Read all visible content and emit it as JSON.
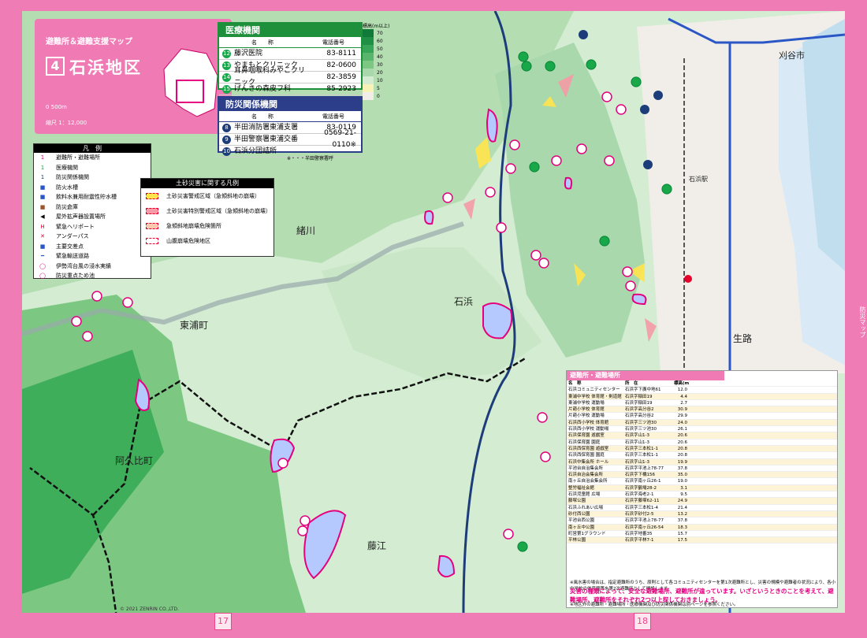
{
  "meta": {
    "sidetab": "防災マップ",
    "page_left": "17",
    "page_right": "18",
    "copyright": "© 2021 ZENRIN CO.,LTD."
  },
  "title": {
    "subtitle": "避難所＆避難支援マップ",
    "number": "4",
    "area": "石浜地区",
    "scale_bar": "0 500m",
    "scale": "縮尺 1：12,000"
  },
  "legend": {
    "title": "凡　例",
    "items": [
      {
        "symbol": "1",
        "color": "#e4007f",
        "label": "避難所・避難場所"
      },
      {
        "symbol": "1",
        "color": "#18a84a",
        "label": "医療機関"
      },
      {
        "symbol": "1",
        "color": "#1d3d7a",
        "label": "防災関係機関"
      },
      {
        "symbol": "■",
        "color": "#2a56c6",
        "label": "防火水槽"
      },
      {
        "symbol": "■",
        "color": "#2a56c6",
        "label": "飲料水兼用耐震性貯水槽"
      },
      {
        "symbol": "■",
        "color": "#a0522d",
        "label": "防災倉庫"
      },
      {
        "symbol": "◀",
        "color": "#000000",
        "label": "屋外拡声器設置場所"
      },
      {
        "symbol": "H",
        "color": "#e4002b",
        "label": "緊急ヘリポート"
      },
      {
        "symbol": "✕",
        "color": "#e4002b",
        "label": "アンダーパス"
      },
      {
        "symbol": "■",
        "color": "#2a56c6",
        "label": "主要交差点"
      },
      {
        "symbol": "━",
        "color": "#2a56c6",
        "label": "緊急輸送道路"
      },
      {
        "symbol": "◯",
        "color": "#e4007f",
        "label": "伊勢湾台風の浸水実績"
      },
      {
        "symbol": "◯",
        "color": "#e4007f",
        "label": "防災重点ため池"
      }
    ]
  },
  "disaster_legend": {
    "title": "土砂災害に関する凡例",
    "items": [
      {
        "color": "#ffe44a",
        "label": "土砂災害警戒区域（急傾斜地の崩壊）"
      },
      {
        "color": "#f59aa6",
        "label": "土砂災害特別警戒区域（急傾斜地の崩壊）"
      },
      {
        "color": "#f8c8b0",
        "label": "急傾斜地崩壊危険箇所"
      },
      {
        "color": "#ffffff",
        "label": "山腹崩壊危険地区"
      }
    ]
  },
  "elevation": {
    "title": "標高(m以上)",
    "levels": [
      {
        "value": "70",
        "color": "#0f7a3a"
      },
      {
        "value": "60",
        "color": "#1f8f45"
      },
      {
        "value": "50",
        "color": "#36a557"
      },
      {
        "value": "40",
        "color": "#5ab56c"
      },
      {
        "value": "30",
        "color": "#7cc882"
      },
      {
        "value": "20",
        "color": "#a9d8ac"
      },
      {
        "value": "10",
        "color": "#d3ecd2"
      },
      {
        "value": "5",
        "color": "#f7f2b5"
      },
      {
        "value": "0",
        "color": "#f1eeea"
      }
    ]
  },
  "medical": {
    "title": "医療機関",
    "col_name": "名　　称",
    "col_phone": "電話番号",
    "rows": [
      {
        "no": "12",
        "name": "藤沢医院",
        "phone": "83-8111"
      },
      {
        "no": "13",
        "name": "やまもとクリニック",
        "phone": "82-0600"
      },
      {
        "no": "14",
        "name": "耳鼻咽喉科みやこクリニック",
        "phone": "82-3859"
      },
      {
        "no": "15",
        "name": "げんきの森皮フ科",
        "phone": "85-2923"
      }
    ]
  },
  "agencies": {
    "title": "防災関係機関",
    "col_name": "名　　称",
    "col_phone": "電話番号",
    "footnote": "※・・・半田警察署呼",
    "rows": [
      {
        "no": "8",
        "name": "半田消防署東浦支署",
        "phone": "83-0119"
      },
      {
        "no": "9",
        "name": "半田警察署東浦交番",
        "phone": "0569-21-0110※"
      },
      {
        "no": "10",
        "name": "石浜分団詰所",
        "phone": ""
      }
    ]
  },
  "places": {
    "ogawa": "緒川",
    "ishihama": "石浜",
    "higashiura": "東浦町",
    "agui": "阿久比町",
    "fujie": "藤江",
    "oji": "生路",
    "kariya": "刈谷市",
    "station": "石浜駅"
  },
  "shelters": {
    "title": "避難所・避難場所",
    "cols": {
      "name": "名　称",
      "address": "所　在",
      "elev": "標高(m)"
    },
    "note": "※風水害の場合は、指定避難所のうち、原則として各コミュニティセンターを第1次避難所とし、災害の規模や避難者の状況により、各小中学校の体育館等を第2次避難所として開設します。",
    "warning": "災害の種類によって、安全な避難場所、避難所が違っています。いざというときのことを考えて、避難場所、避難所をそれぞれ2つ以上探しておきましょう。",
    "footnote": "※地区外の避難所・避難場所・医療機関及び防災関係機関は別ページを参照ください。",
    "rows": [
      {
        "name": "石浜コミュニティセンター",
        "address": "石浜字下廣中地61",
        "elev": "12.0"
      },
      {
        "name": "東浦中学校 体育館・剣道館",
        "address": "石浜字稲田19",
        "elev": "4.4"
      },
      {
        "name": "東浦中学校 運動場",
        "address": "石浜字稲田19",
        "elev": "2.7"
      },
      {
        "name": "片葩小学校 体育館",
        "address": "石浜字高分谷2",
        "elev": "30.9"
      },
      {
        "name": "片葩小学校 運動場",
        "address": "石浜字高分谷2",
        "elev": "29.9"
      },
      {
        "name": "石浜西小学校 体育館",
        "address": "石浜字三ツ池30",
        "elev": "24.0"
      },
      {
        "name": "石浜西小学校 運動場",
        "address": "石浜字三ツ池30",
        "elev": "26.1"
      },
      {
        "name": "石浜保育園 遊戯室",
        "address": "石浜字山1-3",
        "elev": "20.6"
      },
      {
        "name": "石浜保育園 園庭",
        "address": "石浜字山1-3",
        "elev": "20.6"
      },
      {
        "name": "石浜西保育園 遊戯室",
        "address": "石浜字三本松1-1",
        "elev": "20.8"
      },
      {
        "name": "石浜西保育園 園庭",
        "address": "石浜字三本松1-1",
        "elev": "20.8"
      },
      {
        "name": "石浜中集会所 ホール",
        "address": "石浜字山1-3",
        "elev": "19.9"
      },
      {
        "name": "平池台自治集会所",
        "address": "石浜字平池上78-77",
        "elev": "37.8"
      },
      {
        "name": "石浜自治会集会所",
        "address": "石浜字下橋156",
        "elev": "35.0"
      },
      {
        "name": "南ヶ丘自治会集会所",
        "address": "石浜字南ヶ丘26-1",
        "elev": "19.0"
      },
      {
        "name": "整労福祉会館",
        "address": "石浜字鶴場28-2",
        "elev": "3.1"
      },
      {
        "name": "石浜児童館 広場",
        "address": "石浜字海老2-1",
        "elev": "9.5"
      },
      {
        "name": "藤塚公園",
        "address": "石浜字藤塚62-11",
        "elev": "24.9"
      },
      {
        "name": "石浜ふれあい広場",
        "address": "石浜字三本松1-4",
        "elev": "21.4"
      },
      {
        "name": "砂付西公園",
        "address": "石浜字砂付2-5",
        "elev": "13.2"
      },
      {
        "name": "平池台西公園",
        "address": "石浜字平池上78-77",
        "elev": "37.8"
      },
      {
        "name": "南ヶ丘中公園",
        "address": "石浜字南ヶ丘26-54",
        "elev": "18.3"
      },
      {
        "name": "町営第1グラウンド",
        "address": "石浜字地番35",
        "elev": "15.7"
      },
      {
        "name": "平林公園",
        "address": "石浜字平林7-1",
        "elev": "17.5"
      }
    ]
  }
}
